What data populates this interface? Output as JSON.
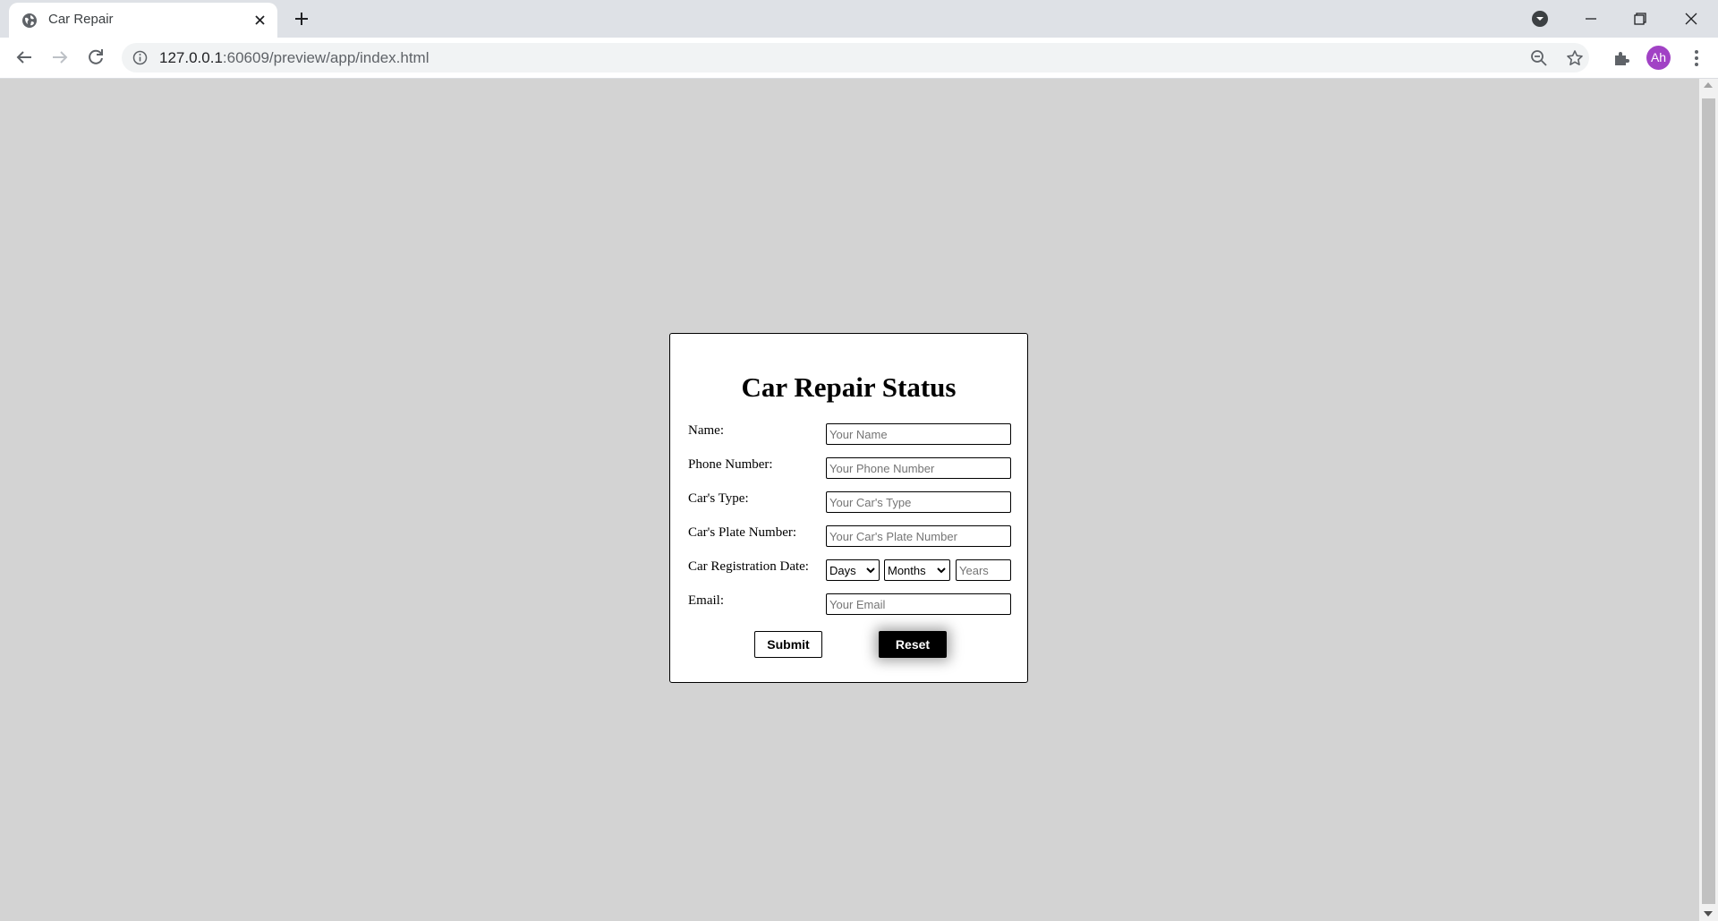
{
  "browser": {
    "tab_title": "Car Repair",
    "url_host": "127.0.0.1",
    "url_rest": ":60609/preview/app/index.html",
    "profile_initials": "Ah",
    "profile_color": "#a142c5"
  },
  "form": {
    "title": "Car Repair Status",
    "fields": {
      "name": {
        "label": "Name:",
        "placeholder": "Your Name"
      },
      "phone": {
        "label": "Phone Number:",
        "placeholder": "Your Phone Number"
      },
      "car_type": {
        "label": "Car's Type:",
        "placeholder": "Your Car's Type"
      },
      "plate": {
        "label": "Car's Plate Number:",
        "placeholder": "Your Car's Plate Number"
      },
      "registration": {
        "label": "Car Registration Date:",
        "days_selected": "Days",
        "months_selected": "Months",
        "years_placeholder": "Years"
      },
      "email": {
        "label": "Email:",
        "placeholder": "Your Email"
      }
    },
    "submit_label": "Submit",
    "reset_label": "Reset"
  },
  "colors": {
    "page_background": "#d3d3d3",
    "reset_button": "#000000"
  }
}
